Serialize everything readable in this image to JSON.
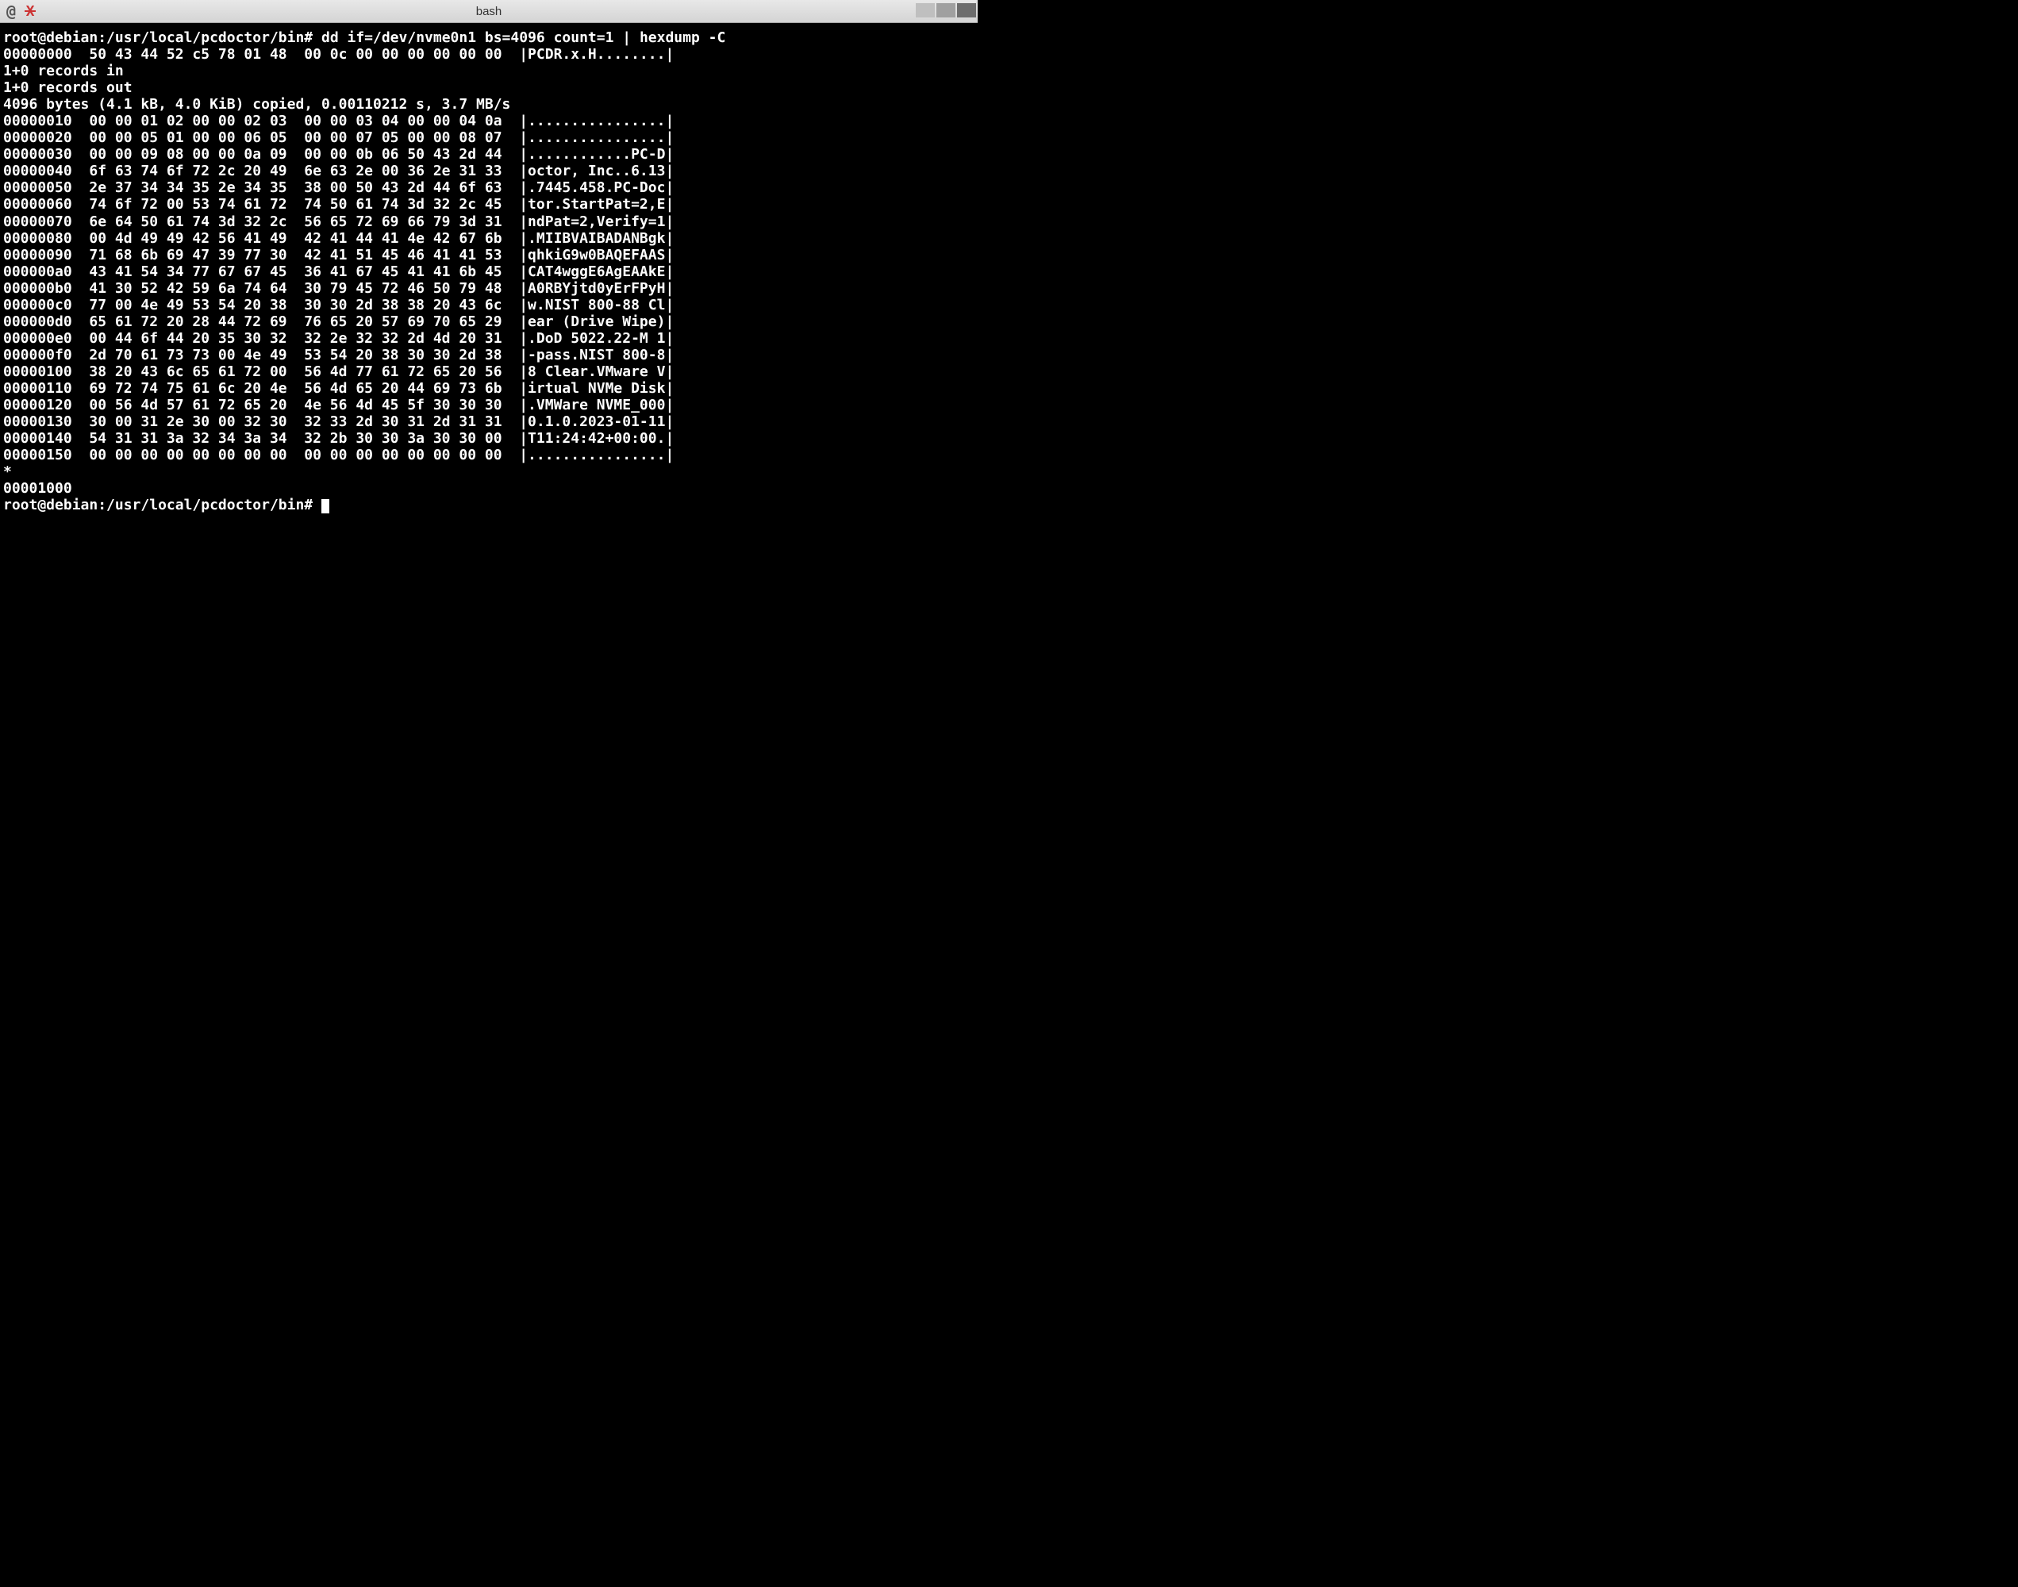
{
  "window": {
    "title": "bash"
  },
  "terminal": {
    "prompt": "root@debian:/usr/local/pcdoctor/bin#",
    "command": "dd if=/dev/nvme0n1 bs=4096 count=1 | hexdump -C",
    "hex_header": "00000000  50 43 44 52 c5 78 01 48  00 0c 00 00 00 00 00 00  |PCDR.x.H........|",
    "dd_status": [
      "1+0 records in",
      "1+0 records out",
      "4096 bytes (4.1 kB, 4.0 KiB) copied, 0.00110212 s, 3.7 MB/s"
    ],
    "hex_lines": [
      "00000010  00 00 01 02 00 00 02 03  00 00 03 04 00 00 04 0a  |................|",
      "00000020  00 00 05 01 00 00 06 05  00 00 07 05 00 00 08 07  |................|",
      "00000030  00 00 09 08 00 00 0a 09  00 00 0b 06 50 43 2d 44  |............PC-D|",
      "00000040  6f 63 74 6f 72 2c 20 49  6e 63 2e 00 36 2e 31 33  |octor, Inc..6.13|",
      "00000050  2e 37 34 34 35 2e 34 35  38 00 50 43 2d 44 6f 63  |.7445.458.PC-Doc|",
      "00000060  74 6f 72 00 53 74 61 72  74 50 61 74 3d 32 2c 45  |tor.StartPat=2,E|",
      "00000070  6e 64 50 61 74 3d 32 2c  56 65 72 69 66 79 3d 31  |ndPat=2,Verify=1|",
      "00000080  00 4d 49 49 42 56 41 49  42 41 44 41 4e 42 67 6b  |.MIIBVAIBADANBgk|",
      "00000090  71 68 6b 69 47 39 77 30  42 41 51 45 46 41 41 53  |qhkiG9w0BAQEFAAS|",
      "000000a0  43 41 54 34 77 67 67 45  36 41 67 45 41 41 6b 45  |CAT4wggE6AgEAAkE|",
      "000000b0  41 30 52 42 59 6a 74 64  30 79 45 72 46 50 79 48  |A0RBYjtd0yErFPyH|",
      "000000c0  77 00 4e 49 53 54 20 38  30 30 2d 38 38 20 43 6c  |w.NIST 800-88 Cl|",
      "000000d0  65 61 72 20 28 44 72 69  76 65 20 57 69 70 65 29  |ear (Drive Wipe)|",
      "000000e0  00 44 6f 44 20 35 30 32  32 2e 32 32 2d 4d 20 31  |.DoD 5022.22-M 1|",
      "000000f0  2d 70 61 73 73 00 4e 49  53 54 20 38 30 30 2d 38  |-pass.NIST 800-8|",
      "00000100  38 20 43 6c 65 61 72 00  56 4d 77 61 72 65 20 56  |8 Clear.VMware V|",
      "00000110  69 72 74 75 61 6c 20 4e  56 4d 65 20 44 69 73 6b  |irtual NVMe Disk|",
      "00000120  00 56 4d 57 61 72 65 20  4e 56 4d 45 5f 30 30 30  |.VMWare NVME_000|",
      "00000130  30 00 31 2e 30 00 32 30  32 33 2d 30 31 2d 31 31  |0.1.0.2023-01-11|",
      "00000140  54 31 31 3a 32 34 3a 34  32 2b 30 30 3a 30 30 00  |T11:24:42+00:00.|",
      "00000150  00 00 00 00 00 00 00 00  00 00 00 00 00 00 00 00  |................|"
    ],
    "hex_tail": [
      "*",
      "00001000"
    ]
  }
}
